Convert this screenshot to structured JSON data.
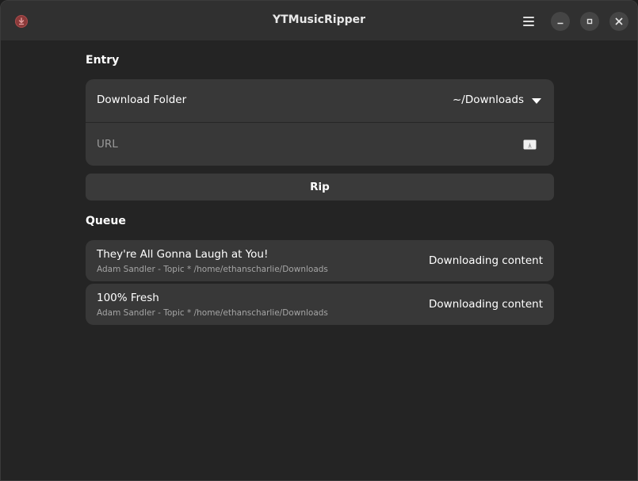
{
  "window": {
    "title": "YTMusicRipper",
    "icons": {
      "app": "download-record-icon",
      "menu": "hamburger-menu-icon",
      "minimize": "minimize-icon",
      "maximize": "maximize-icon",
      "close": "close-icon"
    }
  },
  "entry": {
    "heading": "Entry",
    "download_folder": {
      "label": "Download Folder",
      "value": "~/Downloads",
      "icon": "chevron-down-icon"
    },
    "url": {
      "placeholder": "URL",
      "value": "",
      "icon": "paste-icon"
    },
    "rip_label": "Rip"
  },
  "queue": {
    "heading": "Queue",
    "items": [
      {
        "title": "They're All Gonna Laugh at You!",
        "subtitle": "Adam Sandler - Topic * /home/ethanscharlie/Downloads",
        "status": "Downloading content"
      },
      {
        "title": "100% Fresh",
        "subtitle": "Adam Sandler - Topic * /home/ethanscharlie/Downloads",
        "status": "Downloading content"
      }
    ]
  },
  "colors": {
    "window_bg": "#242424",
    "titlebar_bg": "#303030",
    "card_bg": "#383838",
    "accent_icon": "#8b3a3a"
  }
}
